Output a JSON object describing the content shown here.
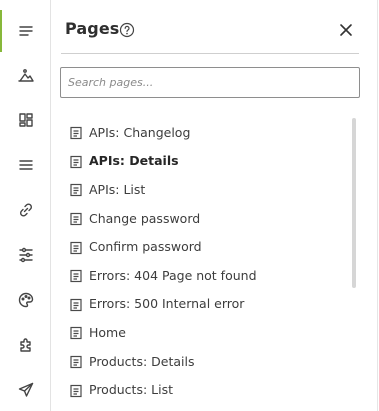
{
  "rail": {
    "items": [
      {
        "name": "menu",
        "icon": "menu-lines-icon",
        "active": true
      },
      {
        "name": "images",
        "icon": "landscape-icon"
      },
      {
        "name": "layout",
        "icon": "grid-icon"
      },
      {
        "name": "list",
        "icon": "list-icon"
      },
      {
        "name": "links",
        "icon": "link-icon"
      },
      {
        "name": "settings",
        "icon": "sliders-icon"
      },
      {
        "name": "theme",
        "icon": "palette-icon"
      },
      {
        "name": "extensions",
        "icon": "puzzle-icon"
      },
      {
        "name": "publish",
        "icon": "send-icon"
      }
    ],
    "accent_color": "#87b83a"
  },
  "panel": {
    "title": "Pages",
    "help_icon": "question-circle-icon",
    "close_icon": "close-icon"
  },
  "search": {
    "placeholder": "Search pages...",
    "value": ""
  },
  "pages": [
    {
      "label": "APIs: Changelog",
      "bold": false
    },
    {
      "label": "APIs: Details",
      "bold": true
    },
    {
      "label": "APIs: List",
      "bold": false
    },
    {
      "label": "Change password",
      "bold": false
    },
    {
      "label": "Confirm password",
      "bold": false
    },
    {
      "label": "Errors: 404 Page not found",
      "bold": false
    },
    {
      "label": "Errors: 500 Internal error",
      "bold": false
    },
    {
      "label": "Home",
      "bold": false
    },
    {
      "label": "Products: Details",
      "bold": false
    },
    {
      "label": "Products: List",
      "bold": false
    }
  ]
}
